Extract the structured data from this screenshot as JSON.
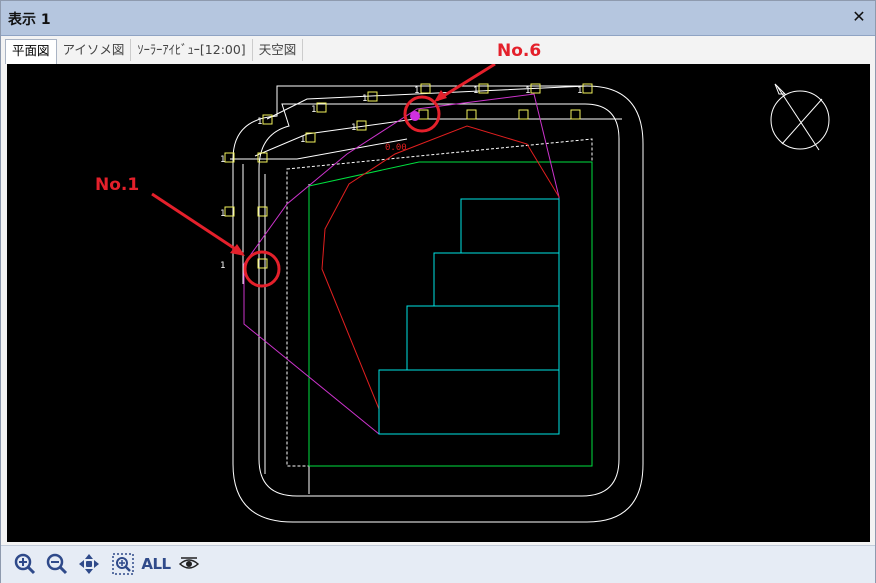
{
  "window": {
    "title": "表示 1",
    "close_glyph": "✕"
  },
  "tabs": [
    {
      "label": "平面図",
      "active": true
    },
    {
      "label": "アイソメ図",
      "active": false
    },
    {
      "label": "ｿｰﾗｰｱｲﾋﾞｭｰ[12:00]",
      "active": false
    },
    {
      "label": "天空図",
      "active": false
    }
  ],
  "annotations": {
    "no1": "No.1",
    "no6": "No.6"
  },
  "drawing": {
    "point_labels": [
      "1",
      "1",
      "1",
      "1",
      "1",
      "1",
      "1",
      "1",
      "1",
      "1",
      "1",
      "1"
    ],
    "red_text": "0.00",
    "colors": {
      "boundary": "#ffffff",
      "building": "#00e5e5",
      "setback": "#00e040",
      "shadow": "#e11f1f",
      "skyline": "#cc33cc",
      "marker": "#f2f25c",
      "annotation": "#e4202b"
    }
  },
  "toolbar": {
    "icons": [
      "zoom-in-icon",
      "zoom-out-icon",
      "pan-icon",
      "zoom-window-icon",
      "all-icon",
      "view-icon"
    ],
    "all_label": "ALL"
  }
}
